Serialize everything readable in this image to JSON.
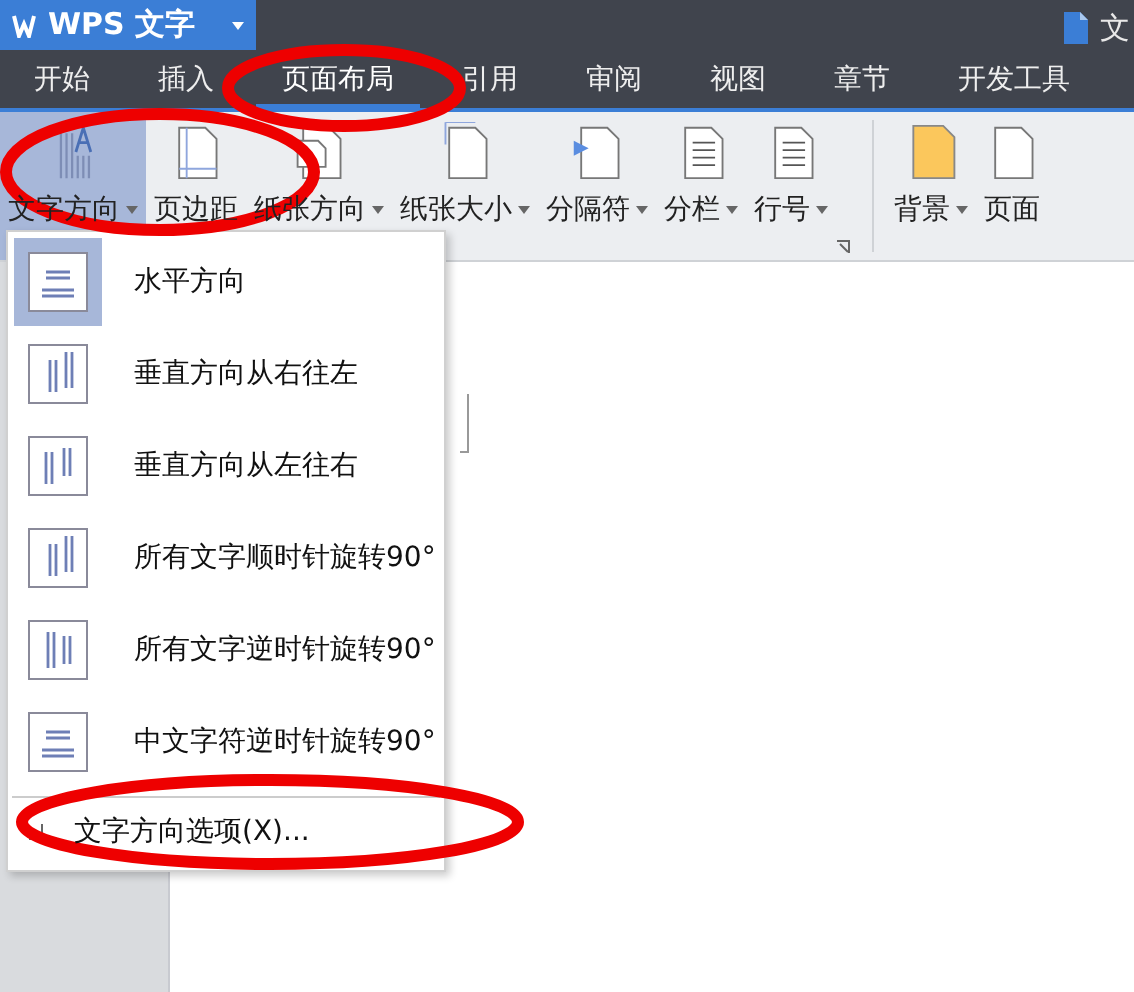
{
  "app_button": {
    "title": "WPS 文字"
  },
  "document_title": "文",
  "tabs": [
    {
      "label": "开始",
      "selected": false
    },
    {
      "label": "插入",
      "selected": false
    },
    {
      "label": "页面布局",
      "selected": true
    },
    {
      "label": "引用",
      "selected": false
    },
    {
      "label": "审阅",
      "selected": false
    },
    {
      "label": "视图",
      "selected": false
    },
    {
      "label": "章节",
      "selected": false
    },
    {
      "label": "开发工具",
      "selected": false
    }
  ],
  "ribbon": [
    {
      "label": "文字方向",
      "kind": "text-direction",
      "dropdown": true,
      "selected": true
    },
    {
      "label": "页边距",
      "kind": "margins",
      "dropdown": false,
      "selected": false
    },
    {
      "label": "纸张方向",
      "kind": "orientation",
      "dropdown": true,
      "selected": false
    },
    {
      "label": "纸张大小",
      "kind": "size",
      "dropdown": true,
      "selected": false
    },
    {
      "label": "分隔符",
      "kind": "breaks",
      "dropdown": true,
      "selected": false
    },
    {
      "label": "分栏",
      "kind": "columns",
      "dropdown": true,
      "selected": false
    },
    {
      "label": "行号",
      "kind": "line-numbers",
      "dropdown": true,
      "selected": false
    },
    {
      "label": "背景",
      "kind": "background",
      "dropdown": true,
      "selected": false
    },
    {
      "label": "页面",
      "kind": "borders",
      "dropdown": false,
      "selected": false
    }
  ],
  "menu": {
    "items": [
      {
        "label": "水平方向",
        "kind": "horizontal",
        "selected": true
      },
      {
        "label": "垂直方向从右往左",
        "kind": "vertical-rtl",
        "selected": false
      },
      {
        "label": "垂直方向从左往右",
        "kind": "vertical-ltr",
        "selected": false
      },
      {
        "label": "所有文字顺时针旋转90°",
        "kind": "rotate-cw",
        "selected": false
      },
      {
        "label": "所有文字逆时针旋转90°",
        "kind": "rotate-ccw",
        "selected": false
      },
      {
        "label": "中文字符逆时针旋转90°",
        "kind": "cjk-ccw",
        "selected": false
      }
    ],
    "footer": "文字方向选项(X)..."
  },
  "annotations": [
    {
      "kind": "ellipse"
    },
    {
      "kind": "ellipse"
    },
    {
      "kind": "ellipse"
    }
  ]
}
